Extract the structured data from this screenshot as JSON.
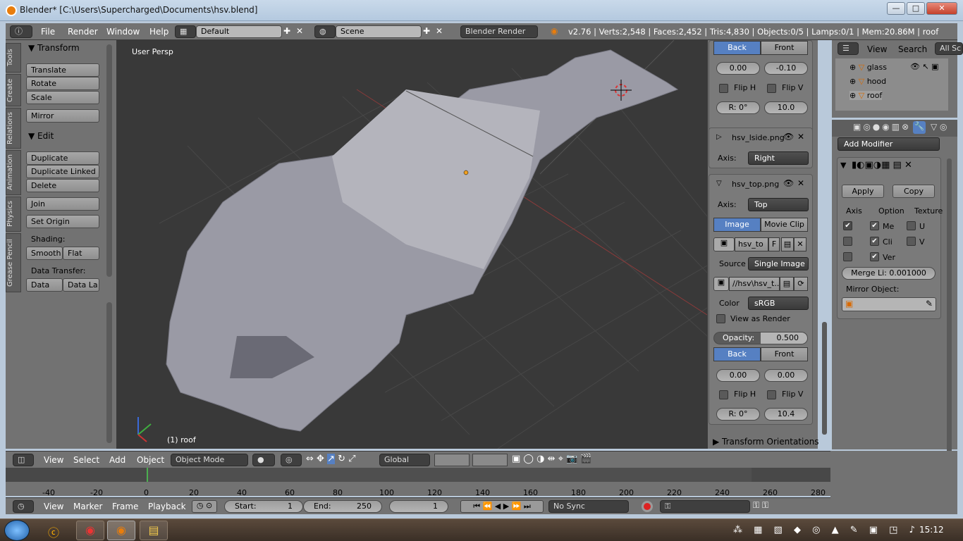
{
  "window": {
    "title": "Blender* [C:\\Users\\Supercharged\\Documents\\hsv.blend]",
    "minimize": "—",
    "maximize": "□",
    "close": "✕"
  },
  "infobar": {
    "menus": [
      "File",
      "Render",
      "Window",
      "Help"
    ],
    "layout": "Default",
    "scene": "Scene",
    "engine": "Blender Render",
    "stats": "v2.76 | Verts:2,548 | Faces:2,452 | Tris:4,830 | Objects:0/5 | Lamps:0/1 | Mem:20.86M | roof"
  },
  "toolshelf": {
    "tabs": [
      "Tools",
      "Create",
      "Relations",
      "Animation",
      "Physics",
      "Grease Pencil"
    ],
    "transform_header": "Transform",
    "transform_buttons": [
      "Translate",
      "Rotate",
      "Scale",
      "Mirror"
    ],
    "edit_header": "Edit",
    "edit_buttons": [
      "Duplicate",
      "Duplicate Linked",
      "Delete",
      "Join"
    ],
    "set_origin": "Set Origin",
    "shading_label": "Shading:",
    "smooth": "Smooth",
    "flat": "Flat",
    "data_transfer_label": "Data Transfer:",
    "data": "Data",
    "data_layout": "Data La"
  },
  "viewport": {
    "label": "User Persp",
    "object_label": "(1) roof"
  },
  "npanel": {
    "bg1": {
      "back": "Back",
      "front": "Front",
      "x": "0.00",
      "y": "-0.10",
      "flip_h": "Flip H",
      "flip_v": "Flip V",
      "rotation": "R: 0°",
      "size": "10.0"
    },
    "bg2": {
      "name": "hsv_lside.png",
      "axis_label": "Axis:",
      "axis": "Right"
    },
    "bg3": {
      "name": "hsv_top.png",
      "axis_label": "Axis:",
      "axis": "Top",
      "image": "Image",
      "movie_clip": "Movie Clip",
      "image_name": "hsv_to",
      "fake": "F",
      "source_label": "Source",
      "source": "Single Image",
      "filepath": "//hsv\\hsv_t...",
      "color_label": "Color",
      "color": "sRGB",
      "view_as_render": "View as Render",
      "opacity_label": "Opacity:",
      "opacity": "0.500",
      "back": "Back",
      "front": "Front",
      "x": "0.00",
      "y": "0.00",
      "flip_h": "Flip H",
      "flip_v": "Flip V",
      "rotation": "R: 0°",
      "size": "10.4"
    },
    "transform_orientations": "Transform Orientations"
  },
  "outliner": {
    "view": "View",
    "search": "Search",
    "all_scenes": "All Sc",
    "items": [
      "glass",
      "hood",
      "roof"
    ]
  },
  "properties": {
    "add_modifier": "Add Modifier",
    "apply": "Apply",
    "copy": "Copy",
    "axis": "Axis",
    "option": "Option",
    "texture": "Texture",
    "opt1": "Me",
    "opt2": "Cli",
    "opt3": "Ver",
    "tex_u": "U",
    "tex_v": "V",
    "merge": "Merge Li: 0.001000",
    "mirror_object": "Mirror Object:"
  },
  "view3d_header": {
    "view": "View",
    "select": "Select",
    "add": "Add",
    "object": "Object",
    "mode": "Object Mode",
    "orientation": "Global"
  },
  "timeline": {
    "ticks": [
      "-40",
      "-20",
      "0",
      "20",
      "40",
      "60",
      "80",
      "100",
      "120",
      "140",
      "160",
      "180",
      "200",
      "220",
      "240",
      "260",
      "280"
    ]
  },
  "timeline_header": {
    "view": "View",
    "marker": "Marker",
    "frame": "Frame",
    "playback": "Playback",
    "start_label": "Start:",
    "start": "1",
    "end_label": "End:",
    "end": "250",
    "current": "1",
    "sync": "No Sync"
  },
  "taskbar": {
    "clock": "15:12"
  },
  "colors": {
    "accent": "#5680c2",
    "panel": "#727272",
    "viewport": "#393939"
  }
}
